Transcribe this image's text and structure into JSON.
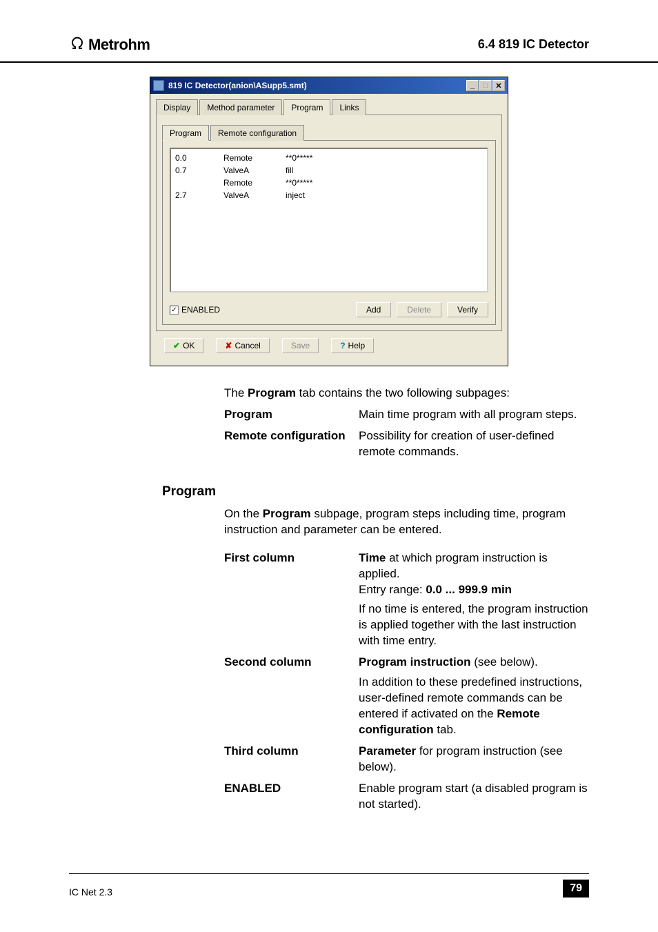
{
  "header": {
    "brand": "Metrohm",
    "section_ref": "6.4  819 IC Detector"
  },
  "dialog": {
    "title": "819 IC Detector(anion\\ASupp5.smt)",
    "tabs_outer": [
      {
        "label": "Display",
        "active": false
      },
      {
        "label": "Method parameter",
        "active": false
      },
      {
        "label": "Program",
        "active": true
      },
      {
        "label": "Links",
        "active": false
      }
    ],
    "tabs_inner": [
      {
        "label": "Program",
        "active": true
      },
      {
        "label": "Remote configuration",
        "active": false
      }
    ],
    "program_rows": [
      {
        "col1": "0.0",
        "col2": "Remote",
        "col3": "**0*****"
      },
      {
        "col1": "0.7",
        "col2": "ValveA",
        "col3": "fill"
      },
      {
        "col1": "",
        "col2": "Remote",
        "col3": "**0*****"
      },
      {
        "col1": "2.7",
        "col2": "ValveA",
        "col3": "inject"
      }
    ],
    "enabled": {
      "label": "ENABLED",
      "checked": true
    },
    "buttons": {
      "add": "Add",
      "delete": "Delete",
      "verify": "Verify"
    },
    "footer_buttons": {
      "ok": "OK",
      "cancel": "Cancel",
      "save": "Save",
      "help": "Help"
    }
  },
  "text": {
    "intro_1": "The ",
    "intro_bold": "Program",
    "intro_2": " tab contains the two following subpages:",
    "defs": [
      {
        "term": "Program",
        "val": "Main time program with all program steps."
      },
      {
        "term": "Remote configuration",
        "val": "Possibility for creation of user-defined remote commands."
      }
    ],
    "program_heading": "Program",
    "program_para_1": "On the ",
    "program_para_bold": "Program",
    "program_para_2": " subpage, program steps including time, program instruction and parameter can be entered.",
    "columns": [
      {
        "term": "First column",
        "parts": [
          {
            "bold": "Time",
            "plain": " at which program instruction is applied."
          },
          {
            "plain": "Entry range: ",
            "bold2": "0.0 ... 999.9 min"
          },
          {
            "plain": "If no time is entered, the program instruction is applied together with the last instruction with time entry."
          }
        ]
      },
      {
        "term": "Second column",
        "parts": [
          {
            "bold": "Program instruction",
            "plain": " (see below)."
          },
          {
            "plain": "In addition to these predefined instructions, user-defined remote commands can be entered if activated on the ",
            "bold2": "Remote configuration",
            "plain2": " tab."
          }
        ]
      },
      {
        "term": "Third column",
        "parts": [
          {
            "bold": "Parameter",
            "plain": " for program instruction (see below)."
          }
        ]
      },
      {
        "term": "ENABLED",
        "parts": [
          {
            "plain": "Enable program start (a disabled program is not started)."
          }
        ]
      }
    ]
  },
  "footer": {
    "left": "IC Net 2.3",
    "page": "79"
  }
}
